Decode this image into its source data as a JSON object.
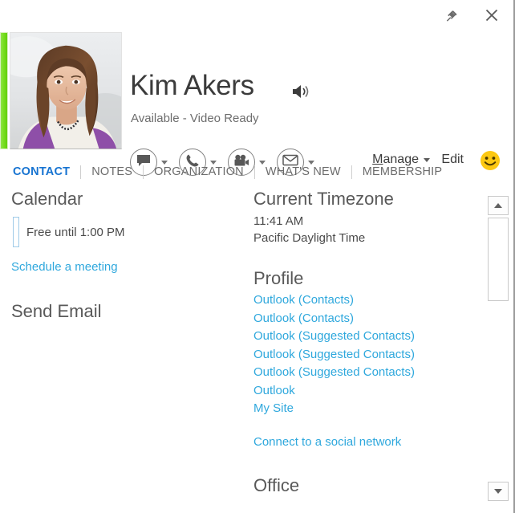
{
  "titlebar": {
    "pin_label": "Pin",
    "close_label": "Close",
    "pin_icon": "pin-icon",
    "close_icon": "close-icon"
  },
  "header": {
    "name": "Kim Akers",
    "status": "Available - Video Ready",
    "presence_color": "#79df21",
    "speaker_icon": "speaker-icon",
    "photo_alt": "Contact photo",
    "actions": [
      {
        "icon": "chat-icon",
        "label": "Send an IM"
      },
      {
        "icon": "phone-icon",
        "label": "Call"
      },
      {
        "icon": "video-icon",
        "label": "Start a video call"
      },
      {
        "icon": "email-icon",
        "label": "Send an email message"
      }
    ],
    "manage_label": "Manage",
    "manage_accesskey": "M",
    "edit_label": "Edit",
    "smiley_icon": "smiley-face-icon",
    "smiley_color": "#fcc813"
  },
  "tabs": [
    {
      "label": "CONTACT",
      "active": true
    },
    {
      "label": "NOTES",
      "active": false
    },
    {
      "label": "ORGANIZATION",
      "active": false
    },
    {
      "label": "WHAT'S NEW",
      "active": false
    },
    {
      "label": "MEMBERSHIP",
      "active": false
    }
  ],
  "left_column": {
    "calendar_heading": "Calendar",
    "free_status": "Free until 1:00 PM",
    "schedule_link": "Schedule a meeting",
    "send_email_heading": "Send Email"
  },
  "right_column": {
    "timezone_heading": "Current Timezone",
    "timezone_time": "11:41 AM",
    "timezone_name": "Pacific Daylight Time",
    "profile_heading": "Profile",
    "profile_links": [
      "Outlook (Contacts)",
      "Outlook (Contacts)",
      "Outlook (Suggested Contacts)",
      "Outlook (Suggested Contacts)",
      "Outlook (Suggested Contacts)",
      "Outlook",
      "My Site"
    ],
    "social_link": "Connect to a social network",
    "office_heading": "Office"
  },
  "scrollbar": {
    "up_icon": "scroll-up-arrow-icon",
    "down_icon": "scroll-down-arrow-icon",
    "thumb_label": "scroll thumb"
  },
  "colors": {
    "link": "#2fa8dd",
    "active_tab": "#1673d1",
    "heading": "#595959",
    "presence_available": "#79df21"
  }
}
